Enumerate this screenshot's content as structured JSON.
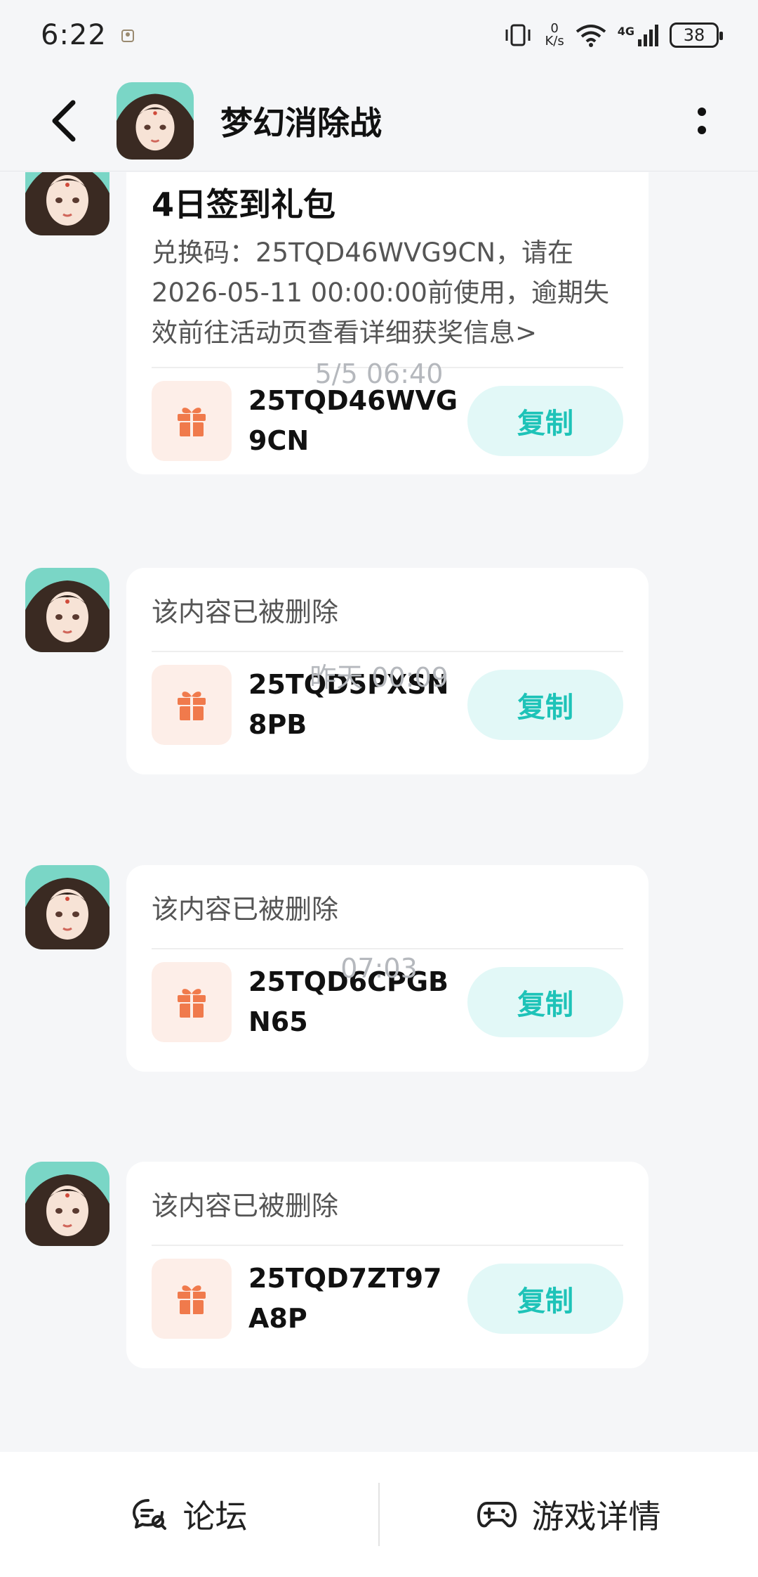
{
  "status_bar": {
    "time": "6:22",
    "net_speed_value": "0",
    "net_speed_unit": "K/s",
    "network": "4G",
    "battery": "38"
  },
  "header": {
    "title": "梦幻消除战"
  },
  "messages": [
    {
      "title": "4日签到礼包",
      "text": "兑换码：25TQD46WVG9CN，请在2026-05-11 00:00:00前使用，逾期失效前往活动页查看详细获奖信息>",
      "code": "25TQD46WVG9CN",
      "copy_label": "复制"
    },
    {
      "timestamp": "5/5  06:40",
      "text": "该内容已被删除",
      "code": "25TQD5PXSN8PB",
      "copy_label": "复制"
    },
    {
      "timestamp": "昨天  00:09",
      "text": "该内容已被删除",
      "code": "25TQD6CPGBN65",
      "copy_label": "复制"
    },
    {
      "timestamp": "07:03",
      "text": "该内容已被删除",
      "code": "25TQD7ZT97A8P",
      "copy_label": "复制"
    }
  ],
  "bottom_bar": {
    "forum_label": "论坛",
    "game_detail_label": "游戏详情"
  },
  "colors": {
    "accent": "#1ec3b8",
    "gift": "#f07a4c",
    "background": "#f5f6f8"
  }
}
